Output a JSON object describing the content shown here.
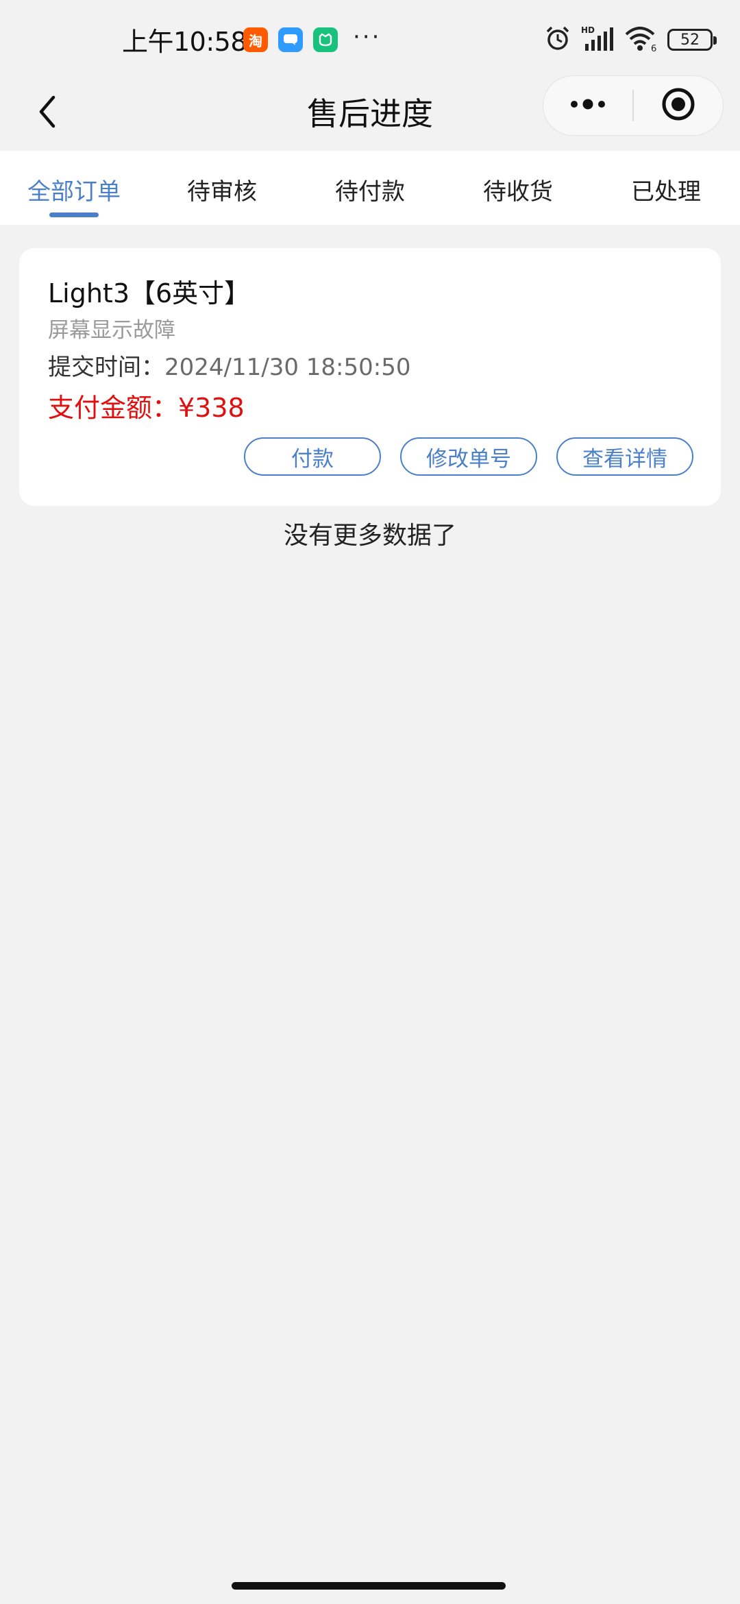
{
  "status_bar": {
    "time": "上午10:58",
    "dots": "···",
    "battery": "52",
    "icons": [
      "taobao-icon",
      "message-icon",
      "mi-home-icon",
      "alarm-icon",
      "signal-icon",
      "wifi-icon",
      "battery-icon"
    ]
  },
  "navbar": {
    "title": "售后进度",
    "back_icon": "chevron-left-icon",
    "more_icon": "more-dots-icon",
    "close_icon": "target-circle-icon"
  },
  "tabs": [
    {
      "label": "全部订单",
      "active": true
    },
    {
      "label": "待审核",
      "active": false
    },
    {
      "label": "待付款",
      "active": false
    },
    {
      "label": "待收货",
      "active": false
    },
    {
      "label": "已处理",
      "active": false
    }
  ],
  "order": {
    "product": "Light3【6英寸】",
    "fault": "屏幕显示故障",
    "submit_label": "提交时间：",
    "submit_time": "2024/11/30 18:50:50",
    "amount_text": "支付金额：¥338",
    "actions": {
      "pay": "付款",
      "modify": "修改单号",
      "details": "查看详情"
    }
  },
  "footer_text": "没有更多数据了",
  "colors": {
    "accent": "#4a7fc9",
    "amount": "#e01010",
    "background": "#f2f2f2"
  }
}
